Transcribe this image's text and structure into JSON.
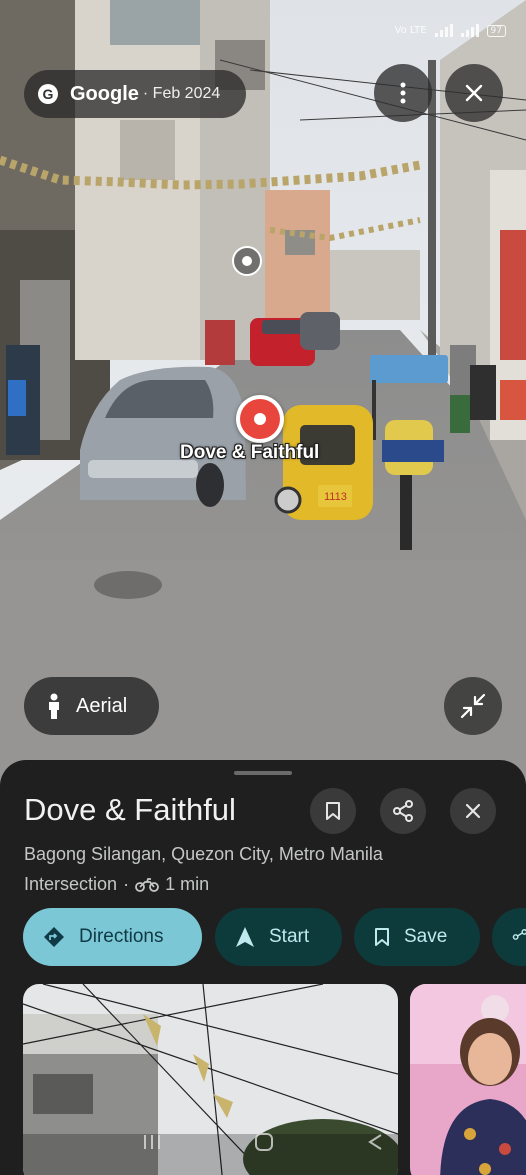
{
  "status": {
    "network": "Vo LTE",
    "battery": "97"
  },
  "street_view": {
    "provider": "Google",
    "date": "· Feb 2024",
    "pin_label": "Dove & Faithful",
    "aerial_label": "Aerial",
    "vehicle_plate": "1113"
  },
  "place": {
    "title": "Dove & Faithful",
    "address": "Bagong Silangan, Quezon City, Metro Manila",
    "type": "Intersection",
    "travel_time": "1 min",
    "travel_mode_icon": "motorcycle-icon"
  },
  "actions": [
    {
      "label": "Directions",
      "icon": "directions-icon"
    },
    {
      "label": "Start",
      "icon": "navigation-arrow-icon"
    },
    {
      "label": "Save",
      "icon": "bookmark-icon"
    }
  ],
  "colors": {
    "primary_chip": "#7cc7d6",
    "dark_chip": "#0d3b3c",
    "pin_red": "#e8453c",
    "sheet_bg": "#1f1f1f"
  }
}
